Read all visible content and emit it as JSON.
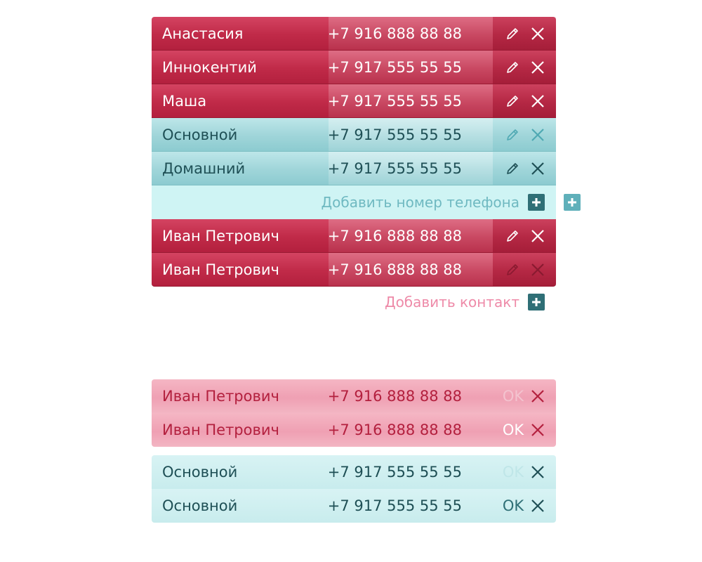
{
  "contacts": [
    {
      "name": "Анастасия",
      "phone": "+7 916 888 88 88"
    },
    {
      "name": "Иннокентий",
      "phone": "+7 917 555 55 55"
    },
    {
      "name": "Маша",
      "phone": "+7 917 555 55 55"
    }
  ],
  "phones": [
    {
      "label": "Основной",
      "phone": "+7 917 555 55 55"
    },
    {
      "label": "Домашний",
      "phone": "+7 917 555 55 55"
    }
  ],
  "add_phone_label": "Добавить номер телефона",
  "contacts_after": [
    {
      "name": "Иван Петрович",
      "phone": "+7 916 888 88 88"
    },
    {
      "name": "Иван Петрович",
      "phone": "+7 916 888 88 88"
    }
  ],
  "add_contact_label": "Добавить контакт",
  "edit_contacts": [
    {
      "name": "Иван Петрович",
      "phone": "+7 916 888 88 88",
      "ok": "OK"
    },
    {
      "name": "Иван Петрович",
      "phone": "+7 916 888 88 88",
      "ok": "OK"
    }
  ],
  "edit_phones": [
    {
      "label": "Основной",
      "phone": "+7 917 555 55 55",
      "ok": "OK"
    },
    {
      "label": "Основной",
      "phone": "+7 917 555 55 55",
      "ok": "OK"
    }
  ],
  "colors": {
    "red": "#c02a48",
    "teal": "#9fd5d9",
    "pink": "#efa0b3",
    "light_teal": "#cff4f4",
    "accent_dark": "#2f6f76"
  },
  "icons": {
    "edit": "pencil-icon",
    "delete": "close-icon",
    "add": "plus-icon"
  }
}
